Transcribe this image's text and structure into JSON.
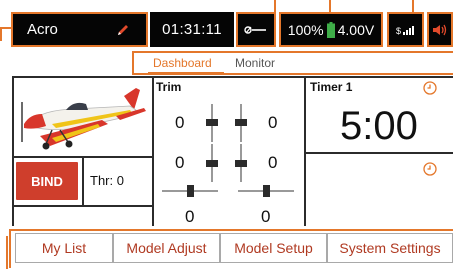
{
  "status_bar": {
    "model_name": "Acro",
    "timer": "01:31:11",
    "battery_percent": "100%",
    "voltage": "4.00V"
  },
  "tabs": [
    {
      "label": "Dashboard",
      "active": true
    },
    {
      "label": "Monitor",
      "active": false
    }
  ],
  "left_panel": {
    "bind_label": "BIND",
    "throttle_label": "Thr: 0"
  },
  "trim": {
    "title": "Trim",
    "values": [
      "0",
      "0",
      "0",
      "0",
      "0",
      "0"
    ]
  },
  "timer_panel": {
    "title": "Timer 1",
    "value": "5:00"
  },
  "bottom_menu": [
    {
      "label": "My List"
    },
    {
      "label": "Model Adjust"
    },
    {
      "label": "Model Setup"
    },
    {
      "label": "System Settings"
    }
  ],
  "colors": {
    "accent": "#e4772b",
    "bind": "#cf3e2c",
    "battery": "#3fae49",
    "volume": "#e24a2b",
    "menu_text": "#b03a22"
  },
  "icons": [
    "pencil-icon",
    "link-icon",
    "battery-icon",
    "signal-icon",
    "volume-icon",
    "clock-icon"
  ]
}
